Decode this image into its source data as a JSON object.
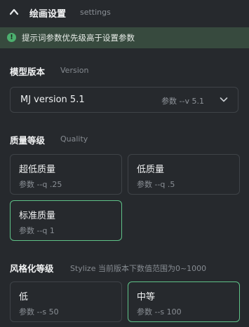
{
  "header": {
    "title": "绘画设置",
    "subtitle": "settings",
    "icon": "chevron-up-icon"
  },
  "notice": {
    "icon": "info-icon",
    "icon_glyph": "!",
    "text": "提示词参数优先级高于设置参数",
    "color": "#4caf6e"
  },
  "version": {
    "title": "模型版本",
    "subtitle": "Version",
    "selected": "MJ version 5.1",
    "param": "参数 --v 5.1"
  },
  "quality": {
    "title": "质量等级",
    "subtitle": "Quality",
    "options": [
      {
        "label": "超低质量",
        "param": "参数 --q .25",
        "selected": false
      },
      {
        "label": "低质量",
        "param": "参数 --q .5",
        "selected": false
      },
      {
        "label": "标准质量",
        "param": "参数 --q 1",
        "selected": true
      }
    ]
  },
  "stylize": {
    "title": "风格化等级",
    "subtitle": "Stylize 当前版本下数值范围为0~1000",
    "options": [
      {
        "label": "低",
        "param": "参数 --s 50",
        "selected": false
      },
      {
        "label": "中等",
        "param": "参数 --s 100",
        "selected": true
      }
    ]
  },
  "colors": {
    "background": "#26292d",
    "accent": "#5fc288",
    "notice_bg": "#374a3e"
  }
}
